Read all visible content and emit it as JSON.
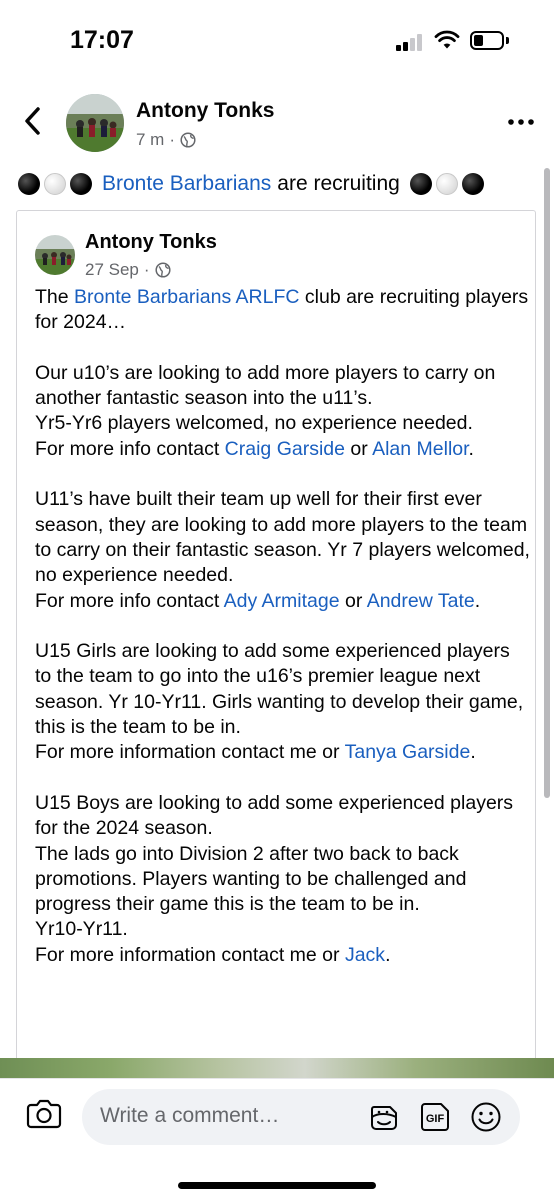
{
  "status_bar": {
    "time": "17:07"
  },
  "post": {
    "author": "Antony Tonks",
    "time": "7 m",
    "headline": {
      "link": "Bronte Barbarians",
      "text": "are recruiting"
    }
  },
  "shared_post": {
    "author": "Antony Tonks",
    "date": "27 Sep",
    "paragraphs": [
      {
        "segments": [
          {
            "t": "The "
          },
          {
            "t": "Bronte Barbarians ARLFC",
            "link": true
          },
          {
            "t": " club are recruiting players for 2024…"
          }
        ]
      },
      {
        "segments": [
          {
            "t": "Our u10’s are looking to add more players to carry on another fantastic season into the u11’s."
          },
          {
            "br": true
          },
          {
            "t": "Yr5-Yr6 players welcomed, no experience needed."
          },
          {
            "br": true
          },
          {
            "t": "For more info contact "
          },
          {
            "t": "Craig Garside",
            "link": true
          },
          {
            "t": " or "
          },
          {
            "t": "Alan Mellor",
            "link": true
          },
          {
            "t": "."
          }
        ]
      },
      {
        "segments": [
          {
            "t": "U11’s have built their team up well for their first ever season, they are looking to add more players to the team to carry on their fantastic season. Yr 7 players welcomed, no experience needed."
          },
          {
            "br": true
          },
          {
            "t": "For more info contact "
          },
          {
            "t": "Ady Armitage",
            "link": true
          },
          {
            "t": " or "
          },
          {
            "t": "Andrew Tate",
            "link": true
          },
          {
            "t": "."
          }
        ]
      },
      {
        "segments": [
          {
            "t": "U15 Girls are looking to add some experienced players to the team to go into the u16’s premier league next season. Yr 10-Yr11. Girls wanting to develop their game, this is the team to be in."
          },
          {
            "br": true
          },
          {
            "t": "For more information contact me or "
          },
          {
            "t": "Tanya Garside",
            "link": true
          },
          {
            "t": "."
          }
        ]
      },
      {
        "segments": [
          {
            "t": "U15 Boys are looking to add some experienced players for the 2024 season."
          },
          {
            "br": true
          },
          {
            "t": "The lads go into Division 2 after two back to back promotions. Players wanting to be challenged and progress their game this is the team to be in."
          },
          {
            "br": true
          },
          {
            "t": "Yr10-Yr11."
          },
          {
            "br": true
          },
          {
            "t": "For more information contact me or "
          },
          {
            "t": "Jack",
            "link": true
          },
          {
            "t": "."
          }
        ]
      }
    ]
  },
  "composer": {
    "placeholder": "Write a comment…",
    "gif_label": "GIF"
  },
  "icons": {
    "back": "chevron-left-icon",
    "more": "more-horizontal-icon",
    "audience": "globe-icon",
    "camera": "camera-icon",
    "sticker": "sticker-icon",
    "gif": "gif-icon",
    "emoji": "emoji-icon"
  },
  "colors": {
    "link": "#1a5fbf",
    "meta_text": "#65676b",
    "input_bg": "#f0f2f5"
  }
}
